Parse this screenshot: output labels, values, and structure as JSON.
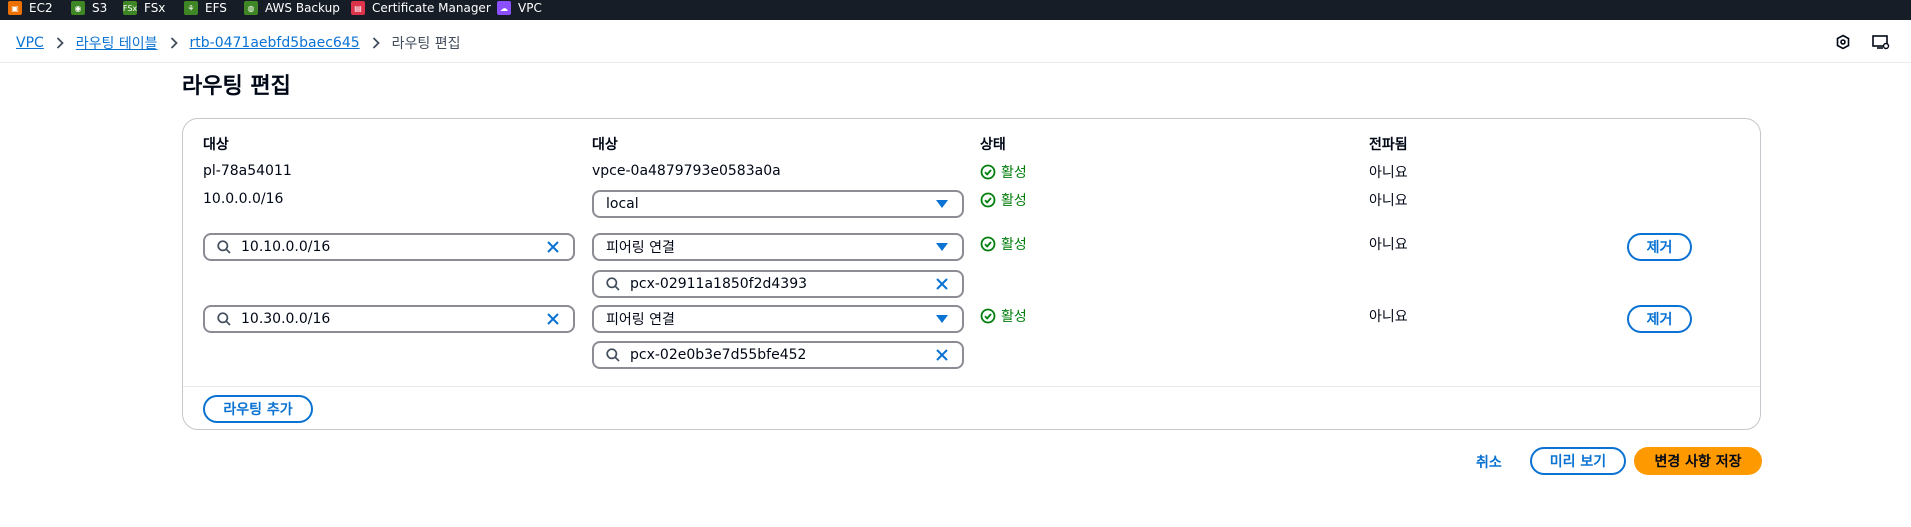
{
  "topbar": {
    "services": [
      {
        "label": "EC2",
        "icon": "ec2-icon",
        "color": "#ed7100"
      },
      {
        "label": "S3",
        "icon": "s3-icon",
        "color": "#3f8624"
      },
      {
        "label": "FSx",
        "icon": "fsx-icon",
        "color": "#3f8624",
        "badge": "FSx"
      },
      {
        "label": "EFS",
        "icon": "efs-icon",
        "color": "#3f8624"
      },
      {
        "label": "AWS Backup",
        "icon": "aws-backup-icon",
        "color": "#3f8624"
      },
      {
        "label": "Certificate Manager",
        "icon": "certificate-manager-icon",
        "color": "#dd344c"
      },
      {
        "label": "VPC",
        "icon": "vpc-icon",
        "color": "#8c4fff"
      }
    ]
  },
  "breadcrumb": {
    "items": [
      "VPC",
      "라우팅 테이블",
      "rtb-0471aebfd5baec645"
    ],
    "current": "라우팅 편집"
  },
  "page": {
    "title": "라우팅 편집"
  },
  "table": {
    "headers": [
      "대상",
      "대상",
      "상태",
      "전파됨"
    ],
    "rows": [
      {
        "destination": "pl-78a54011",
        "target": "vpce-0a4879793e0583a0a",
        "status": "활성",
        "propagated": "아니요"
      },
      {
        "destination": "10.0.0.0/16",
        "target": "local",
        "status": "활성",
        "propagated": "아니요"
      },
      {
        "destination": "10.10.0.0/16",
        "target": "피어링 연결",
        "target_id": "pcx-02911a1850f2d4393",
        "status": "활성",
        "propagated": "아니요",
        "remove": "제거"
      },
      {
        "destination": "10.30.0.0/16",
        "target": "피어링 연결",
        "target_id": "pcx-02e0b3e7d55bfe452",
        "status": "활성",
        "propagated": "아니요",
        "remove": "제거"
      }
    ],
    "add_route": "라우팅 추가"
  },
  "footer": {
    "cancel": "취소",
    "preview": "미리 보기",
    "save": "변경 사항 저장"
  },
  "colors": {
    "link": "#0972d3",
    "success": "#037f0c",
    "primary": "#ff9900",
    "topbar": "#161d26"
  }
}
